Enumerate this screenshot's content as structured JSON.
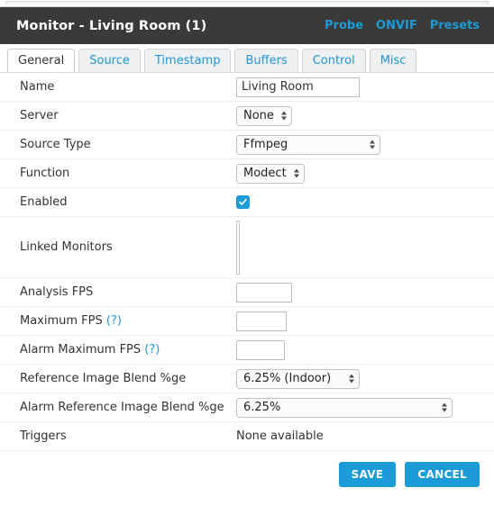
{
  "header": {
    "title": "Monitor - Living Room (1)",
    "links": [
      {
        "label": "Probe",
        "name": "probe"
      },
      {
        "label": "ONVIF",
        "name": "onvif"
      },
      {
        "label": "Presets",
        "name": "presets"
      }
    ],
    "link_color": "#1b9bd8",
    "background": "#3a3a38"
  },
  "tabs": [
    {
      "label": "General",
      "active": true
    },
    {
      "label": "Source",
      "active": false
    },
    {
      "label": "Timestamp",
      "active": false
    },
    {
      "label": "Buffers",
      "active": false
    },
    {
      "label": "Control",
      "active": false
    },
    {
      "label": "Misc",
      "active": false
    }
  ],
  "form": {
    "name": {
      "label": "Name",
      "value": "Living Room",
      "placeholder": ""
    },
    "server": {
      "label": "Server",
      "value": "None"
    },
    "source_type": {
      "label": "Source Type",
      "value": "Ffmpeg"
    },
    "function": {
      "label": "Function",
      "value": "Modect"
    },
    "enabled": {
      "label": "Enabled",
      "checked": true,
      "checkbox_color": "#1b9bd8"
    },
    "linked_monitors": {
      "label": "Linked Monitors",
      "value": ""
    },
    "analysis_fps": {
      "label": "Analysis FPS",
      "value": "",
      "placeholder": ""
    },
    "maximum_fps": {
      "label": "Maximum FPS",
      "help": "(?)",
      "value": "",
      "placeholder": ""
    },
    "alarm_maximum_fps": {
      "label": "Alarm Maximum FPS",
      "help": "(?)",
      "value": "",
      "placeholder": ""
    },
    "reference_image_blend": {
      "label": "Reference Image Blend %ge",
      "value": "6.25% (Indoor)"
    },
    "alarm_reference_image_blend": {
      "label": "Alarm Reference Image Blend %ge",
      "value": "6.25%"
    },
    "triggers": {
      "label": "Triggers",
      "value": "None available"
    }
  },
  "footer": {
    "save_label": "SAVE",
    "cancel_label": "CANCEL",
    "button_color": "#1b9bd8"
  }
}
